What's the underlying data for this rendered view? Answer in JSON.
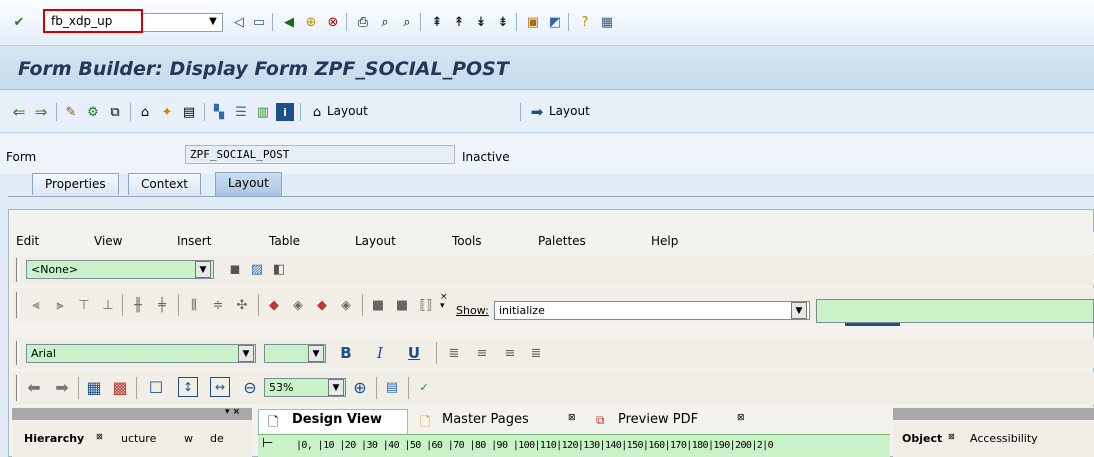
{
  "toolbar": {
    "command_value": "fb_xdp_up",
    "icons": [
      "enter-icon",
      "back-icon",
      "save-icon",
      "back-nav-icon",
      "exit-icon",
      "cancel-icon",
      "print-icon",
      "find-icon",
      "find-next-icon",
      "first-page-icon",
      "prev-page-icon",
      "next-page-icon",
      "last-page-icon",
      "new-session-icon",
      "shortcut-icon",
      "help-icon",
      "customize-icon"
    ]
  },
  "title": "Form Builder: Display Form ZPF_SOCIAL_POST",
  "app_toolbar": {
    "layout_label_1": "Layout",
    "layout_label_2": "Layout"
  },
  "form": {
    "label": "Form",
    "value": "ZPF_SOCIAL_POST",
    "status": "Inactive"
  },
  "tabs": [
    {
      "label": "Properties"
    },
    {
      "label": "Context"
    },
    {
      "label": "Layout"
    }
  ],
  "designer": {
    "menu": [
      "Edit",
      "View",
      "Insert",
      "Table",
      "Layout",
      "Tools",
      "Palettes",
      "Help"
    ],
    "style_combo": "<None>",
    "show_label": "Show:",
    "show_value": "initialize",
    "font_value": "Arial",
    "zoom_value": "53%",
    "panel_tabs": [
      "Hierarchy",
      "ucture",
      "w",
      "de"
    ],
    "view_tabs": [
      "Design View",
      "Master Pages",
      "Preview PDF"
    ],
    "ruler": "|0, |10 |20 |30 |40 |50 |60 |70 |80 |90 |100|110|120|130|140|150|160|170|180|190|200|2|0",
    "right_tabs": [
      "Object",
      "Accessibility"
    ]
  },
  "colors": {
    "accent_red": "#d40000",
    "title_color": "#1f3957",
    "green_field": "#c9f2c9"
  }
}
